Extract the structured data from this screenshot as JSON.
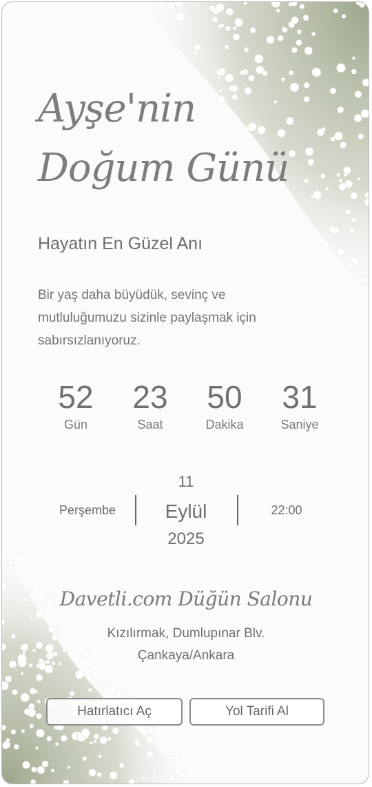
{
  "invitation": {
    "title_line1": "Ayşe'nin",
    "title_line2": "Doğum Günü",
    "subtitle": "Hayatın En Güzel Anı",
    "description": "Bir yaş daha büyüdük, sevinç ve mutluluğumuzu sizinle paylaşmak için sabırsızlanıyoruz."
  },
  "countdown": [
    {
      "value": "52",
      "label": "Gün"
    },
    {
      "value": "23",
      "label": "Saat"
    },
    {
      "value": "50",
      "label": "Dakika"
    },
    {
      "value": "31",
      "label": "Saniye"
    }
  ],
  "event_date": {
    "day_name": "Perşembe",
    "day": "11",
    "month": "Eylül",
    "year": "2025",
    "time": "22:00"
  },
  "venue": {
    "name": "Davetli.com Düğün Salonu",
    "address_line1": "Kızılırmak, Dumlupınar Blv.",
    "address_line2": "Çankaya/Ankara"
  },
  "actions": {
    "reminder_label": "Hatırlatıcı Aç",
    "directions_label": "Yol Tarifi Al"
  },
  "colors": {
    "text": "#6f6f6f",
    "border": "#8a8a8a",
    "background": "#fbfbfb",
    "flower_green": "#9aa58a"
  },
  "decorations": [
    "baby-breath-flowers-top-right",
    "baby-breath-flowers-bottom-left"
  ]
}
